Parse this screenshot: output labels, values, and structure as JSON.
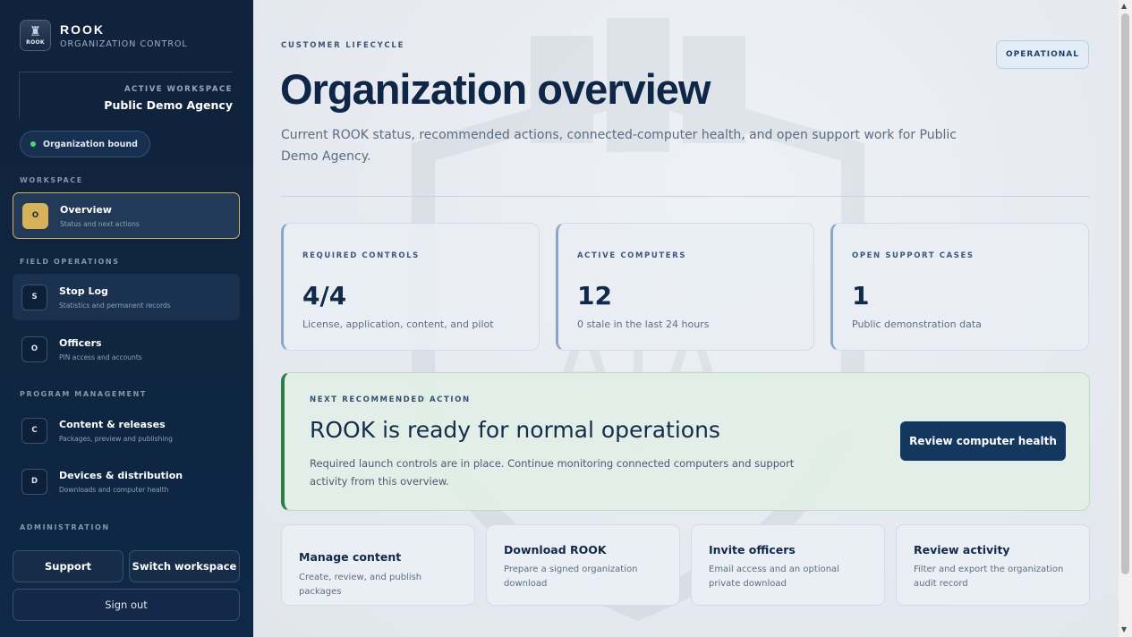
{
  "brand": {
    "name": "ROOK",
    "subtitle": "ORGANIZATION CONTROL",
    "logo_text": "ROOK",
    "logo_icon": "rook-tower-icon"
  },
  "workspace": {
    "label": "ACTIVE WORKSPACE",
    "name": "Public Demo Agency"
  },
  "binding": {
    "label": "Organization bound",
    "status_color": "#4fd07a"
  },
  "sidebar": {
    "sections": {
      "workspace": "WORKSPACE",
      "field_operations": "FIELD OPERATIONS",
      "program_management": "PROGRAM MANAGEMENT",
      "administration": "ADMINISTRATION"
    },
    "items": [
      {
        "badge": "O",
        "label": "Overview",
        "desc": "Status and next actions",
        "active": true
      },
      {
        "badge": "S",
        "label": "Stop Log",
        "desc": "Statistics and permanent records"
      },
      {
        "badge": "O",
        "label": "Officers",
        "desc": "PIN access and accounts"
      },
      {
        "badge": "C",
        "label": "Content & releases",
        "desc": "Packages, preview and publishing"
      },
      {
        "badge": "D",
        "label": "Devices & distribution",
        "desc": "Downloads and computer health"
      }
    ],
    "buttons": {
      "support": "Support",
      "switch_workspace": "Switch workspace",
      "sign_out": "Sign out"
    }
  },
  "header": {
    "eyebrow": "CUSTOMER LIFECYCLE",
    "title": "Organization overview",
    "subtitle": "Current ROOK status, recommended actions, connected-computer health, and open support work for Public Demo Agency.",
    "status": "OPERATIONAL"
  },
  "stats": [
    {
      "label": "REQUIRED CONTROLS",
      "value": "4/4",
      "note": "License, application, content, and pilot"
    },
    {
      "label": "ACTIVE COMPUTERS",
      "value": "12",
      "note": "0 stale in the last 24 hours"
    },
    {
      "label": "OPEN SUPPORT CASES",
      "value": "1",
      "note": "Public demonstration data"
    }
  ],
  "next_action": {
    "label": "NEXT RECOMMENDED ACTION",
    "title": "ROOK is ready for normal operations",
    "desc": "Required launch controls are in place. Continue monitoring connected computers and support activity from this overview.",
    "button": "Review computer health",
    "accent": "#2e7d44"
  },
  "actions": [
    {
      "title": "Manage content",
      "desc": "Create, review, and publish packages"
    },
    {
      "title": "Download ROOK",
      "desc": "Prepare a signed organization download"
    },
    {
      "title": "Invite officers",
      "desc": "Email access and an optional private download"
    },
    {
      "title": "Review activity",
      "desc": "Filter and export the organization audit record"
    }
  ],
  "colors": {
    "sidebar_bg": "#10223c",
    "active_accent": "#d6b25b",
    "primary_button": "#143760",
    "title_text": "#0f2646"
  }
}
